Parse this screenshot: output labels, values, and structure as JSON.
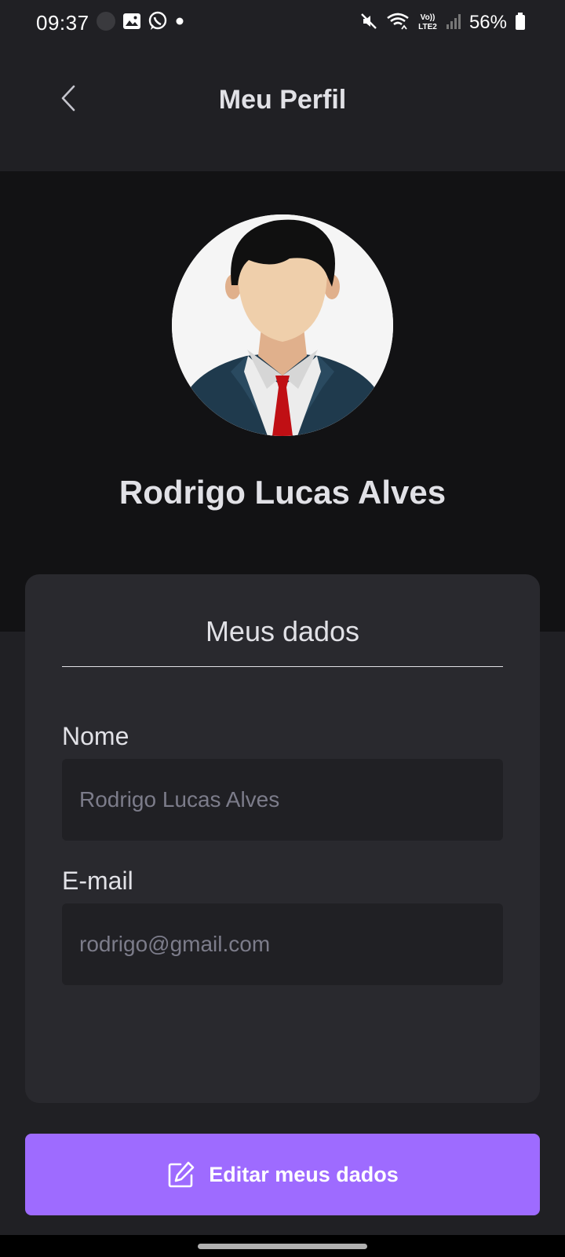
{
  "status_bar": {
    "time": "09:37",
    "battery_text": "56%",
    "left_icons": [
      "toggle-icon",
      "gallery-icon",
      "whatsapp-icon",
      "dot-icon"
    ],
    "right_icons": [
      "mute-icon",
      "wifi-icon",
      "volte-icon",
      "signal-icon",
      "battery-icon"
    ],
    "network_label": "Vo) LTE2"
  },
  "header": {
    "title": "Meu Perfil"
  },
  "profile": {
    "name": "Rodrigo Lucas Alves"
  },
  "card": {
    "title": "Meus dados",
    "fields": [
      {
        "label": "Nome",
        "value": "",
        "placeholder": "Rodrigo Lucas Alves"
      },
      {
        "label": "E-mail",
        "value": "",
        "placeholder": "rodrigo@gmail.com"
      }
    ]
  },
  "edit_button": {
    "label": "Editar meus dados"
  },
  "colors": {
    "background": "#202024",
    "profile_band": "#121214",
    "card": "#29292e",
    "input": "#202024",
    "accent": "#9e6bff",
    "text": "#e1e1e6",
    "placeholder": "#7c7c8a"
  }
}
